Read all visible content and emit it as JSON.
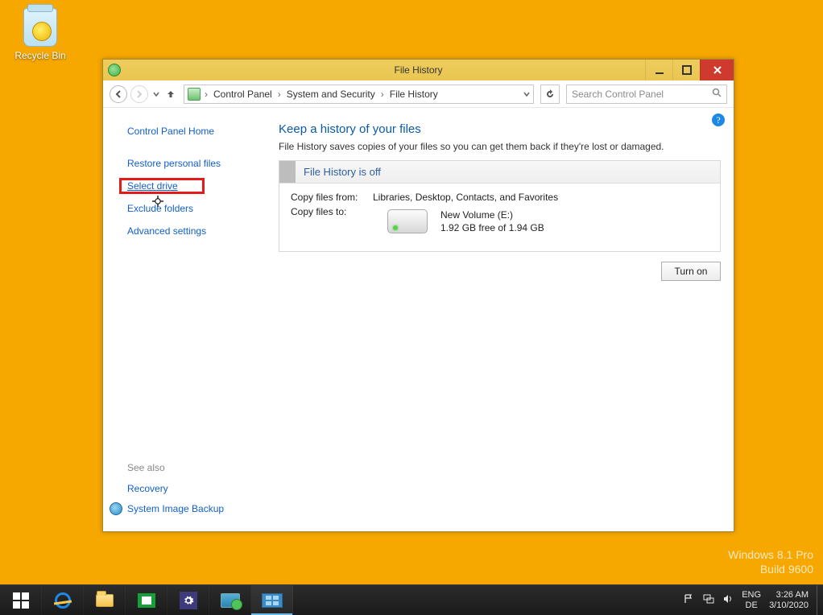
{
  "desktop": {
    "recycle_bin_label": "Recycle Bin",
    "watermark_line1": "Windows 8.1 Pro",
    "watermark_line2": "Build 9600"
  },
  "window": {
    "title": "File History",
    "breadcrumbs": {
      "seg1": "Control Panel",
      "seg2": "System and Security",
      "seg3": "File History"
    },
    "search": {
      "placeholder": "Search Control Panel"
    },
    "sidebar": {
      "home": "Control Panel Home",
      "links": {
        "restore": "Restore personal files",
        "select_drive": "Select drive",
        "exclude": "Exclude folders",
        "advanced": "Advanced settings"
      },
      "seealso": "See also",
      "recovery": "Recovery",
      "sysimg": "System Image Backup"
    },
    "main": {
      "heading": "Keep a history of your files",
      "subtitle": "File History saves copies of your files so you can get them back if they're lost or damaged.",
      "status_title": "File History is off",
      "copy_from_label": "Copy files from:",
      "copy_from_value": "Libraries, Desktop, Contacts, and Favorites",
      "copy_to_label": "Copy files to:",
      "drive_name": "New Volume (E:)",
      "drive_free": "1.92 GB free of 1.94 GB",
      "turn_on": "Turn on"
    }
  },
  "taskbar": {
    "lang1": "ENG",
    "lang2": "DE",
    "time": "3:26 AM",
    "date": "3/10/2020"
  }
}
